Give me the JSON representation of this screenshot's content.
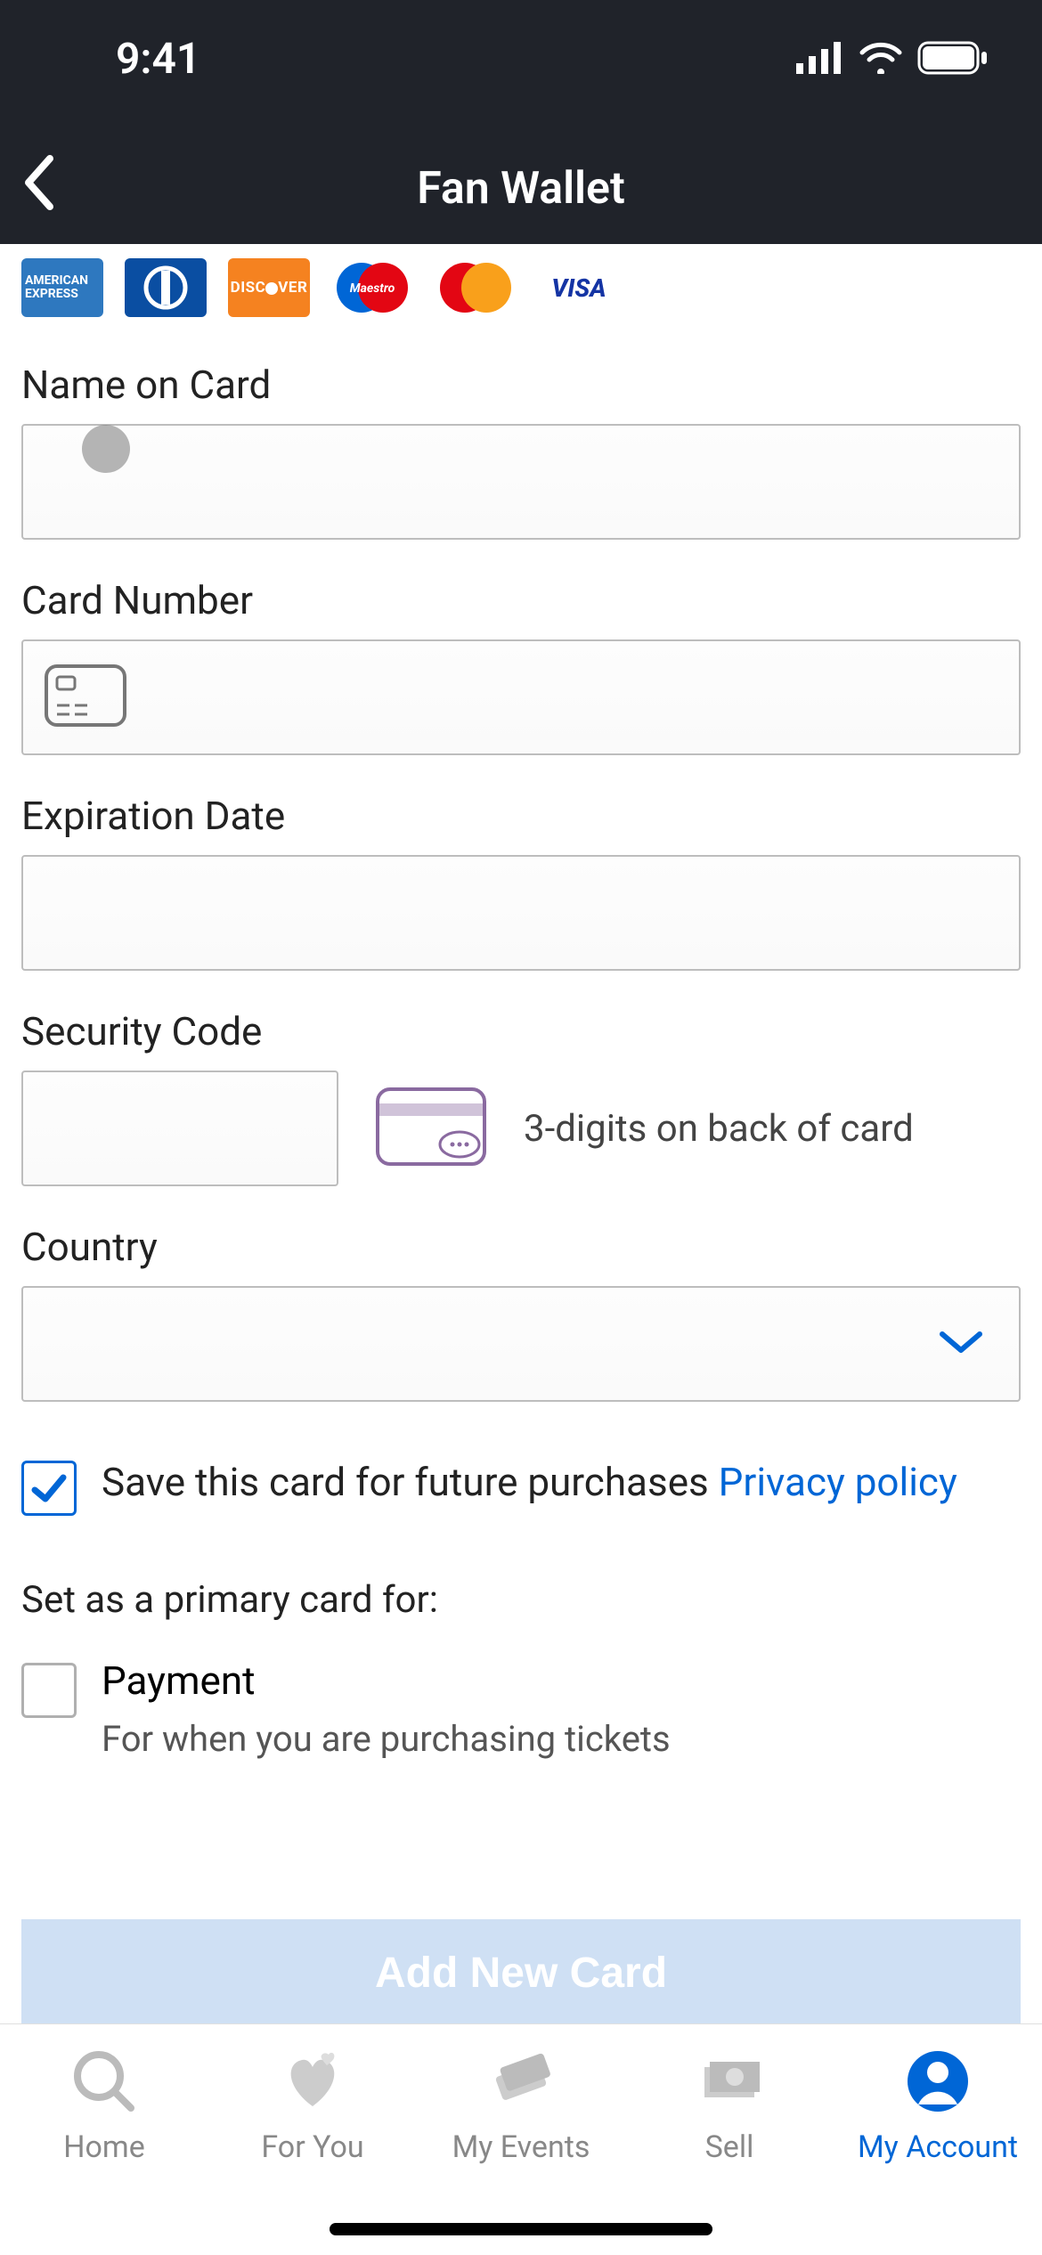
{
  "status": {
    "time": "9:41"
  },
  "header": {
    "title": "Fan Wallet"
  },
  "card_logos": {
    "amex": "AMERICAN EXPRESS",
    "discover": "DISCOVER",
    "visa": "VISA"
  },
  "form": {
    "name_label": "Name on Card",
    "number_label": "Card Number",
    "exp_label": "Expiration Date",
    "sec_label": "Security Code",
    "sec_hint": "3-digits on back of card",
    "country_label": "Country"
  },
  "save": {
    "text": "Save this card for future purchases ",
    "privacy": "Privacy policy"
  },
  "primary": {
    "heading": "Set as a primary card for:",
    "payment_label": "Payment",
    "payment_sub": "For when you are purchasing tickets"
  },
  "cta": {
    "add_card": "Add New Card"
  },
  "tabs": {
    "home": "Home",
    "foryou": "For You",
    "events": "My Events",
    "sell": "Sell",
    "account": "My Account"
  }
}
